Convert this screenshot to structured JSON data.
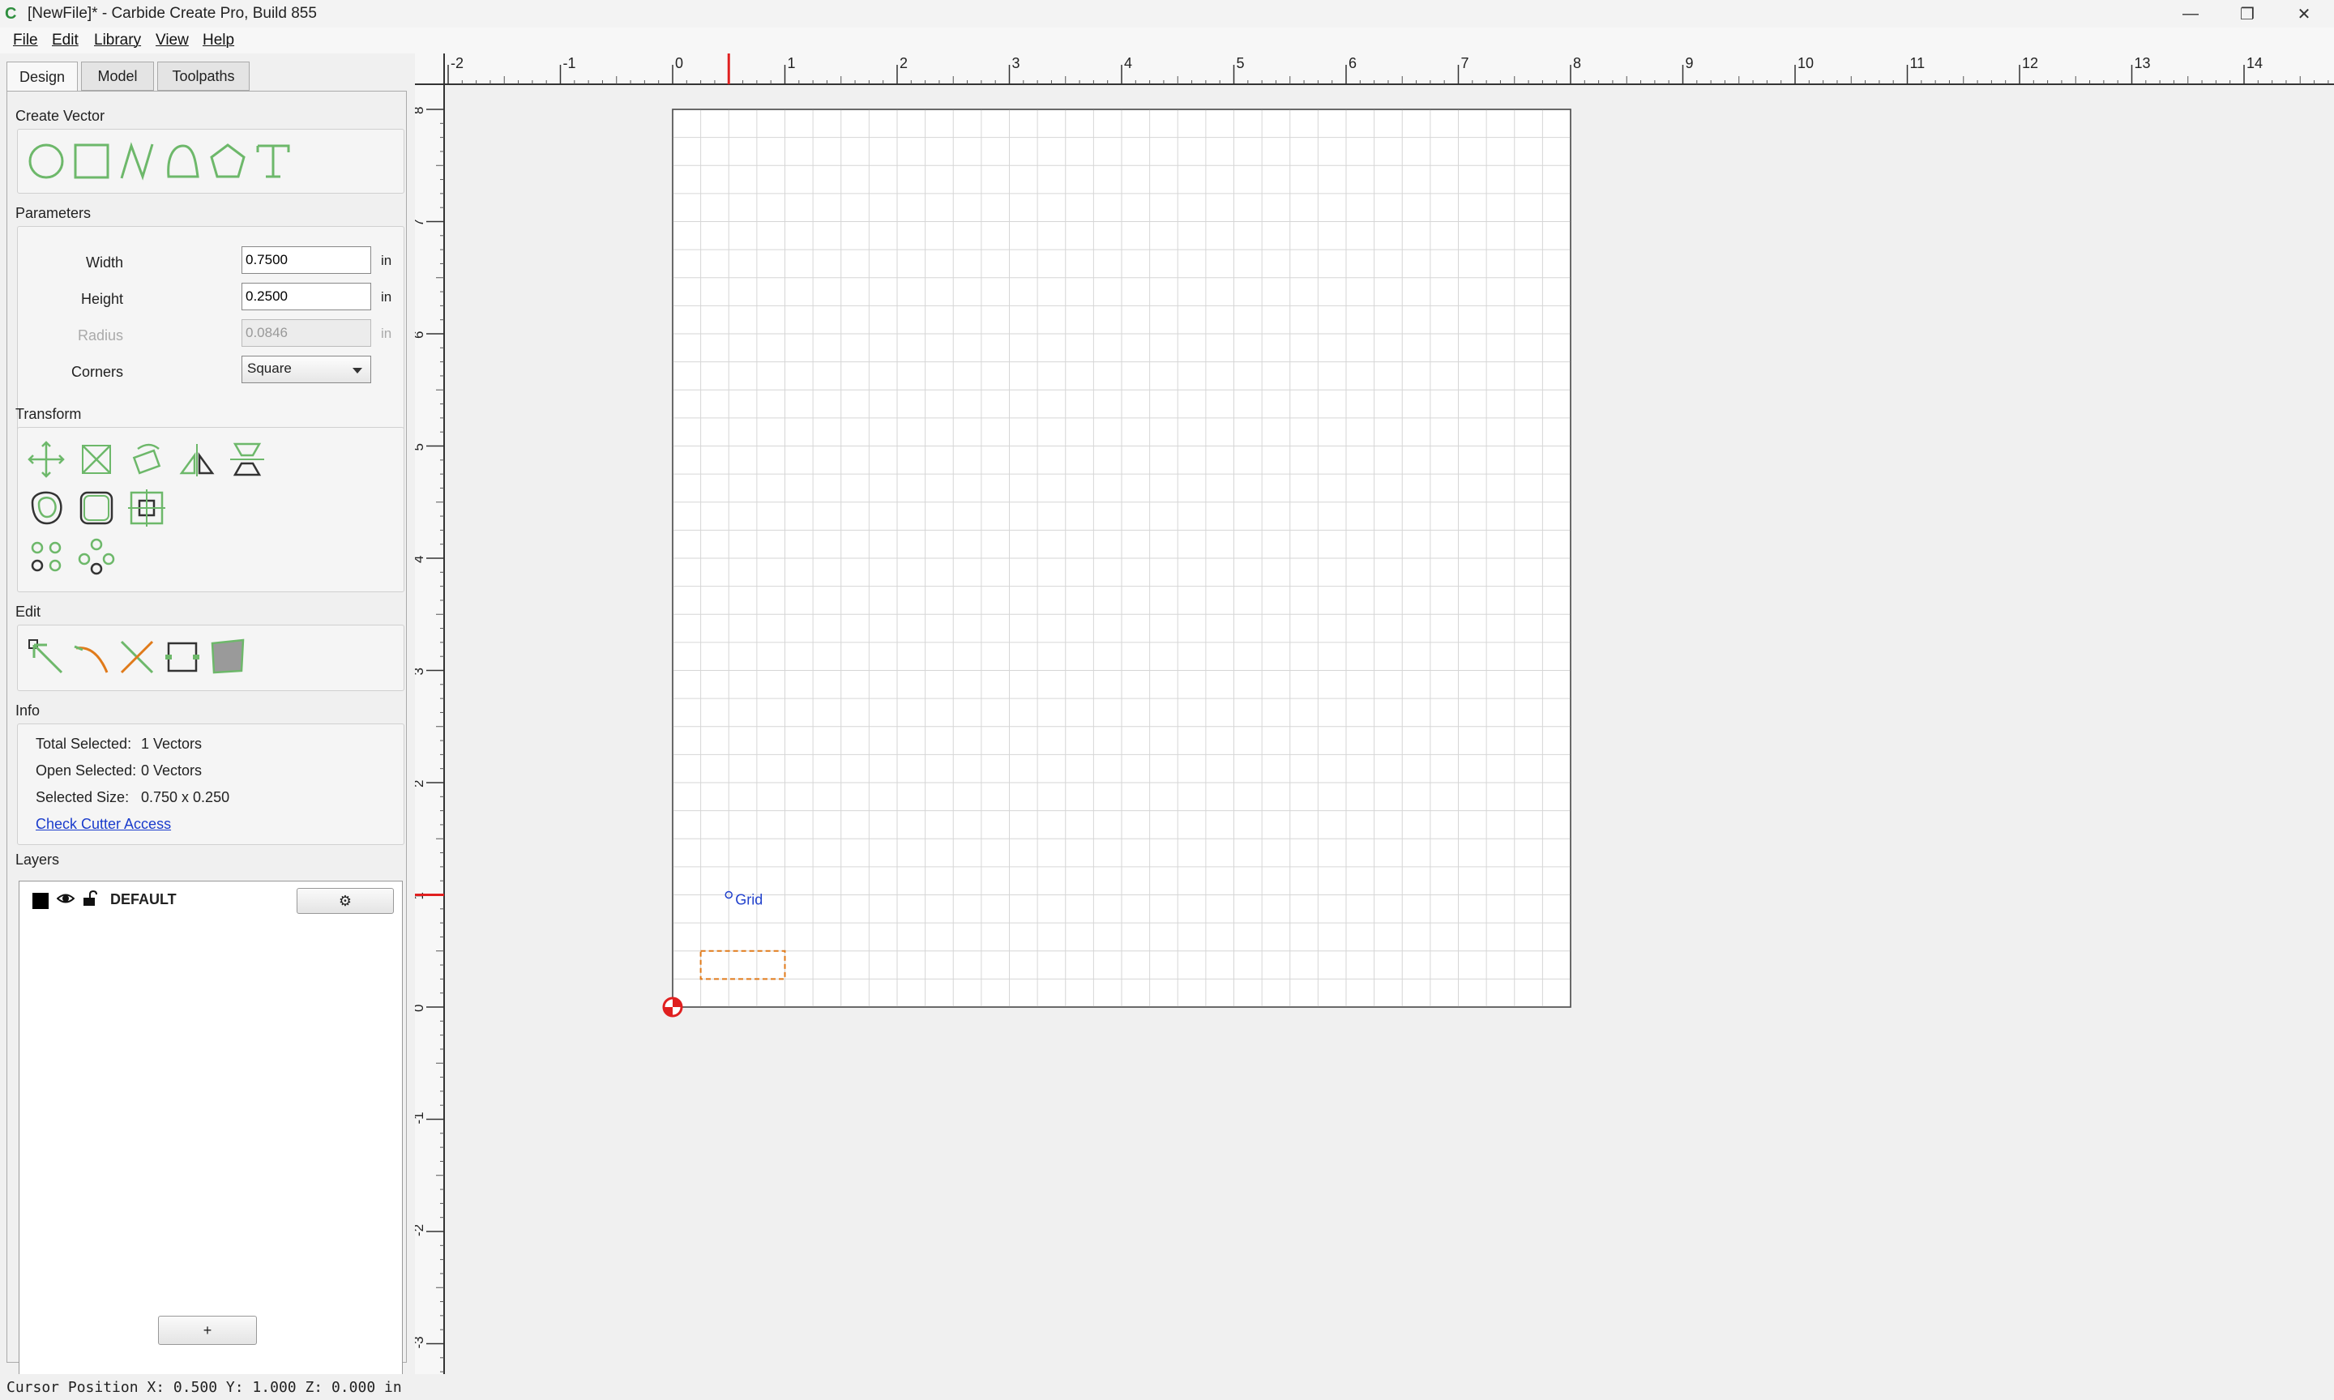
{
  "window": {
    "title": "[NewFile]* - Carbide Create Pro, Build 855",
    "minimize": "—",
    "restore": "❐",
    "close": "✕"
  },
  "menu": [
    "File",
    "Edit",
    "Library",
    "View",
    "Help"
  ],
  "tabs": [
    "Design",
    "Model",
    "Toolpaths"
  ],
  "sections": {
    "create_vector": "Create Vector",
    "parameters": "Parameters",
    "transform": "Transform",
    "edit": "Edit",
    "info": "Info",
    "layers": "Layers"
  },
  "parameters": {
    "width_label": "Width",
    "width_value": "0.7500",
    "width_unit": "in",
    "height_label": "Height",
    "height_value": "0.2500",
    "height_unit": "in",
    "radius_label": "Radius",
    "radius_value": "0.0846",
    "radius_unit": "in",
    "corners_label": "Corners",
    "corners_value": "Square"
  },
  "info": {
    "total_label": "Total Selected:",
    "total_value": "1 Vectors",
    "open_label": "Open Selected:",
    "open_value": "0 Vectors",
    "size_label": "Selected Size:",
    "size_value": "0.750 x 0.250",
    "check_link": "Check Cutter Access"
  },
  "layers": {
    "items": [
      {
        "name": "DEFAULT",
        "color": "#000000"
      }
    ],
    "add_label": "+"
  },
  "canvas": {
    "grid_label": "Grid",
    "ruler_x_ticks": [
      "-2",
      "-1",
      "0",
      "1",
      "2",
      "3",
      "4",
      "5",
      "6",
      "7",
      "8",
      "9",
      "10",
      "11",
      "12",
      "13",
      "14"
    ],
    "ruler_y_ticks": [
      "8",
      "7",
      "6",
      "5",
      "4",
      "3",
      "2",
      "1",
      "0",
      "-1",
      "-2",
      "-3"
    ]
  },
  "status": {
    "cursor": "Cursor Position X: 0.500 Y: 1.000 Z: 0.000 in"
  },
  "colors": {
    "tool_green": "#6db86a",
    "selection": "#e07a1a",
    "cursor_marker": "#e02020"
  }
}
